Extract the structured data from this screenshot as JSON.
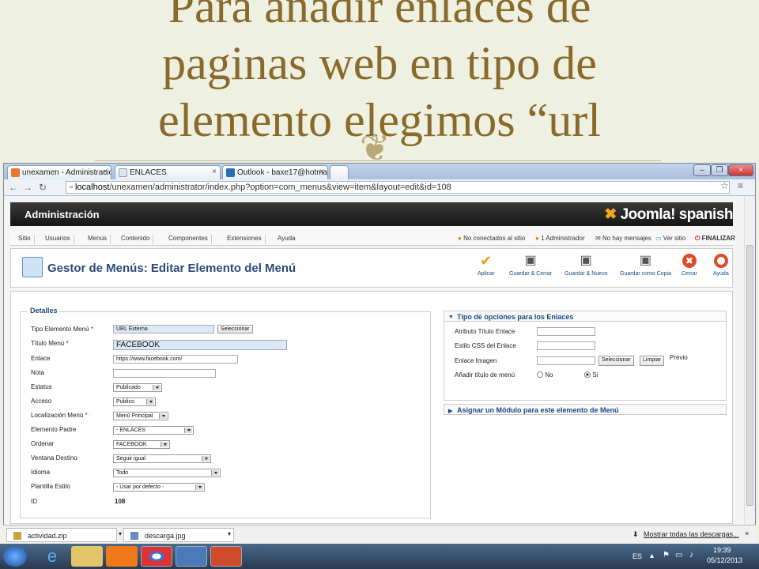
{
  "slide": {
    "title_lines": [
      "Para añadir enlaces de",
      "paginas web en tipo de",
      "elemento elegimos “url"
    ]
  },
  "browser": {
    "tabs": [
      {
        "label": "unexamen - Administració",
        "icon": "joomla-icon",
        "color": "#e8772e"
      },
      {
        "label": "ENLACES",
        "icon": "page-icon",
        "color": "#dde6f0"
      },
      {
        "label": "Outlook - baxe17@hotma",
        "icon": "outlook-icon",
        "color": "#2a6db8"
      }
    ],
    "url_host": "localhost",
    "url_path": "/unexamen/administrator/index.php?option=com_menus&view=item&layout=edit&id=108"
  },
  "admin": {
    "title": "Administración",
    "logo": "Joomla! spanish",
    "menu": [
      "Sitio",
      "Usuarios",
      "Menús",
      "Contenido",
      "Componentes",
      "Extensiones",
      "Ayuda"
    ],
    "status": {
      "online": "No conectados al sitio",
      "admins": "1 Administrador",
      "messages": "No hay mensajes",
      "view_site": "Ver sitio",
      "logout": "FINALIZAR"
    },
    "page_title": "Gestor de Menús: Editar Elemento del Menú",
    "toolbar": [
      "Aplicar",
      "Guardar & Cerrar",
      "Guardar & Nuevo",
      "Guardar como Copia",
      "Cerrar",
      "Ayuda"
    ]
  },
  "details": {
    "legend": "Detalles",
    "type_label": "Tipo Elemento Menú",
    "type_value": "URL Externa",
    "select_btn": "Seleccionar",
    "title_label": "Título Menú",
    "title_value": "FACEBOOK",
    "link_label": "Enlace",
    "link_value": "https://www.facebook.com/",
    "note_label": "Nota",
    "note_value": "",
    "status_label": "Estatus",
    "status_value": "Publicado",
    "access_label": "Acceso",
    "access_value": "Publico",
    "menu_label": "Localización Menú",
    "menu_value": "Menú Principal",
    "parent_label": "Elemento Padre",
    "parent_value": "- ENLACES",
    "order_label": "Ordenar",
    "order_value": "FACEBOOK",
    "target_label": "Ventana Destino",
    "target_value": "Seguir igual",
    "lang_label": "Idioma",
    "lang_value": "Todo",
    "style_label": "Plantilla Estilo",
    "style_value": "- Usar por defecto -",
    "id_label": "ID",
    "id_value": "108"
  },
  "link_options": {
    "header": "Tipo de opciones para los Enlaces",
    "title_attr_label": "Atributo Título Enlace",
    "css_label": "Estilo CSS del Enlace",
    "image_label": "Enlace Imagen",
    "select_btn": "Seleccionar",
    "clear_btn": "Limpiar",
    "preview": "Previo",
    "add_title_label": "Añadir título de menú",
    "no": "No",
    "yes": "Si",
    "selected": "Si"
  },
  "module_header": "Asignar un Módulo para este elemento de Menú",
  "downloads": {
    "items": [
      "actividad.zip",
      "descarga.jpg"
    ],
    "show_all": "Mostrar todas las descargas..."
  },
  "taskbar": {
    "lang": "ES",
    "time": "19:39",
    "date": "05/12/2013"
  }
}
